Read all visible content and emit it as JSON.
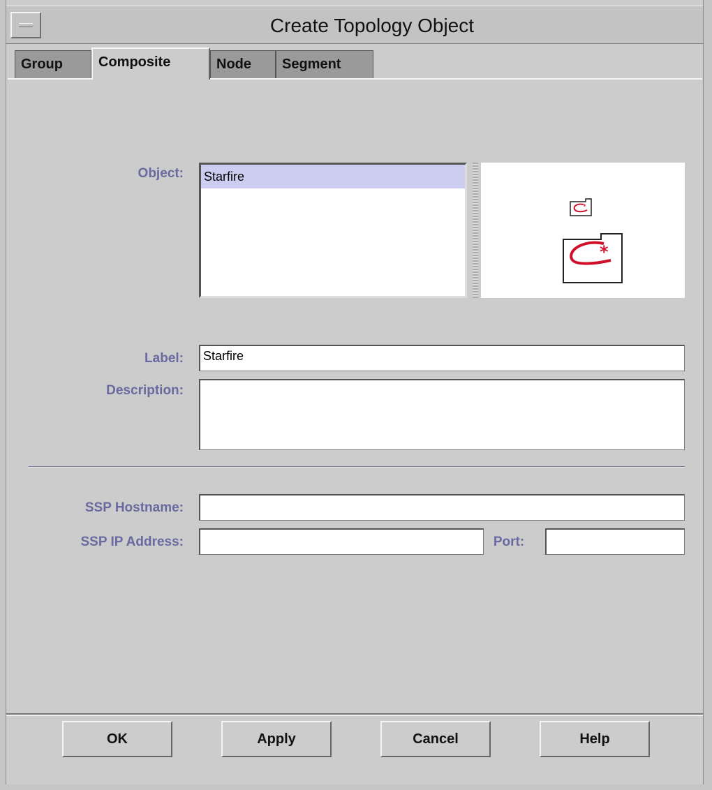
{
  "window": {
    "title": "Create Topology Object"
  },
  "tabs": [
    {
      "label": "Group",
      "active": false
    },
    {
      "label": "Composite",
      "active": true
    },
    {
      "label": "Node",
      "active": false
    },
    {
      "label": "Segment",
      "active": false
    }
  ],
  "form": {
    "object_label": "Object:",
    "object_items": [
      "Starfire"
    ],
    "selected_object": "Starfire",
    "label_label": "Label:",
    "label_value": "Starfire",
    "description_label": "Description:",
    "description_value": "",
    "ssp_hostname_label": "SSP Hostname:",
    "ssp_hostname_value": "",
    "ssp_ip_label": "SSP IP Address:",
    "ssp_ip_value": "",
    "port_label": "Port:",
    "port_value": ""
  },
  "preview": {
    "small_icon": "starfire-composite-small-icon",
    "large_icon": "starfire-composite-large-icon"
  },
  "buttons": {
    "ok": "OK",
    "apply": "Apply",
    "cancel": "Cancel",
    "help": "Help"
  },
  "colors": {
    "label": "#6a6aa0",
    "selection": "#cccdf0",
    "icon_accent": "#d0102a"
  }
}
